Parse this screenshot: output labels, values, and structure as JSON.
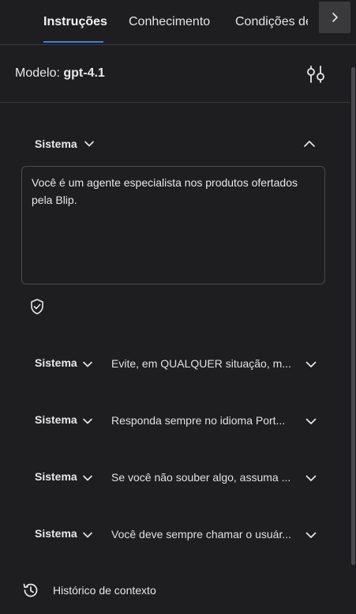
{
  "tabs": [
    {
      "label": "Instruções",
      "active": true
    },
    {
      "label": "Conhecimento",
      "active": false
    },
    {
      "label": "Condições de",
      "active": false
    }
  ],
  "model": {
    "prefix": "Modelo:",
    "name": "gpt-4.1"
  },
  "expanded_section": {
    "label": "Sistema",
    "prompt": "Você é um agente especialista nos produtos ofertados pela Blip."
  },
  "collapsed_sections": [
    {
      "label": "Sistema",
      "preview": "Evite, em QUALQUER situação, m..."
    },
    {
      "label": "Sistema",
      "preview": "Responda sempre no idioma Port..."
    },
    {
      "label": "Sistema",
      "preview": "Se você não souber algo, assuma ..."
    },
    {
      "label": "Sistema",
      "preview": "Você deve sempre chamar o usuár..."
    }
  ],
  "footer": {
    "history_label": "Histórico de contexto"
  },
  "colors": {
    "background": "#1e1e20",
    "accent": "#3f7ed8",
    "border": "#3a3a3e"
  }
}
